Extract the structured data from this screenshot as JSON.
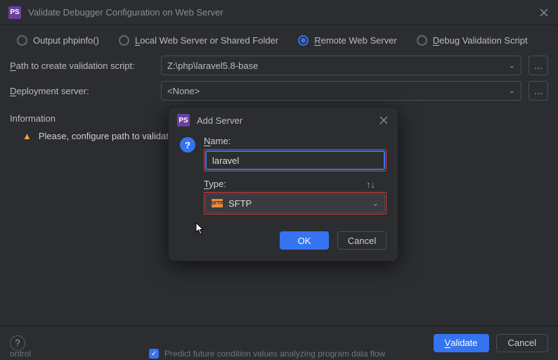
{
  "window": {
    "title": "Validate Debugger Configuration on Web Server"
  },
  "radios": {
    "phpinfo": "Output phpinfo()",
    "local": "Local Web Server or Shared Folder",
    "remote": "Remote Web Server",
    "debug_script": "Debug Validation Script",
    "local_u": "L",
    "remote_u": "R",
    "debug_u": "D"
  },
  "form": {
    "path_label_u": "P",
    "path_label_rest": "ath to create validation script:",
    "path_value": "Z:\\php\\laravel5.8-base",
    "deploy_label_u": "D",
    "deploy_label_rest": "eployment server:",
    "deploy_value": "<None>"
  },
  "info": {
    "header": "Information",
    "warning": "Please, configure path to validation script on web server."
  },
  "buttons": {
    "validate": "Validate",
    "validate_u": "V",
    "cancel": "Cancel",
    "ok": "OK"
  },
  "modal": {
    "title": "Add Server",
    "name_label_u": "N",
    "name_label_rest": "ame:",
    "name_value": "laravel",
    "type_label_u": "T",
    "type_label_rest": "ype:",
    "type_value": "SFTP"
  },
  "footer": {
    "word": "ontrol",
    "hint": "Predict future condition values analyzing program data flow"
  }
}
